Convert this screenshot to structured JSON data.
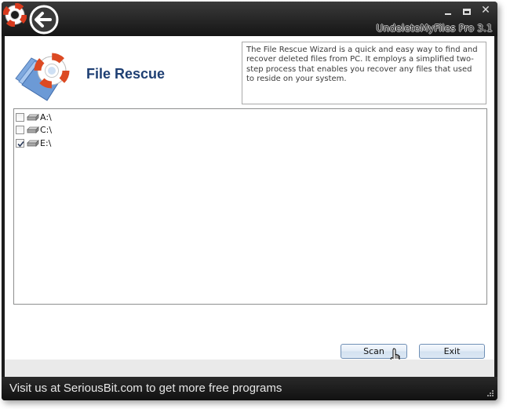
{
  "window": {
    "title": "UndeleteMyFiles Pro 3.1"
  },
  "header": {
    "title": "File Rescue",
    "description": "The File Rescue Wizard is a quick and easy way to find and recover deleted files from PC. It employs a simplified two-step process that enables you recover any files that used to reside on your system."
  },
  "drives": [
    {
      "label": "A:\\",
      "checked": false
    },
    {
      "label": "C:\\",
      "checked": false
    },
    {
      "label": "E:\\",
      "checked": true
    }
  ],
  "buttons": {
    "scan_label": "Scan",
    "exit_label": "Exit"
  },
  "statusbar": {
    "link_text": "Visit us at SeriousBit.com to get more free programs"
  },
  "icons": {
    "app_logo": "lifebuoy-icon",
    "back": "back-arrow-icon",
    "header": "folder-lifebuoy-icon",
    "drive": "drive-icon"
  },
  "colors": {
    "title_accent": "#1e3f73",
    "chrome_dark": "#1c1c1c",
    "button_border": "#6f8fb5"
  }
}
